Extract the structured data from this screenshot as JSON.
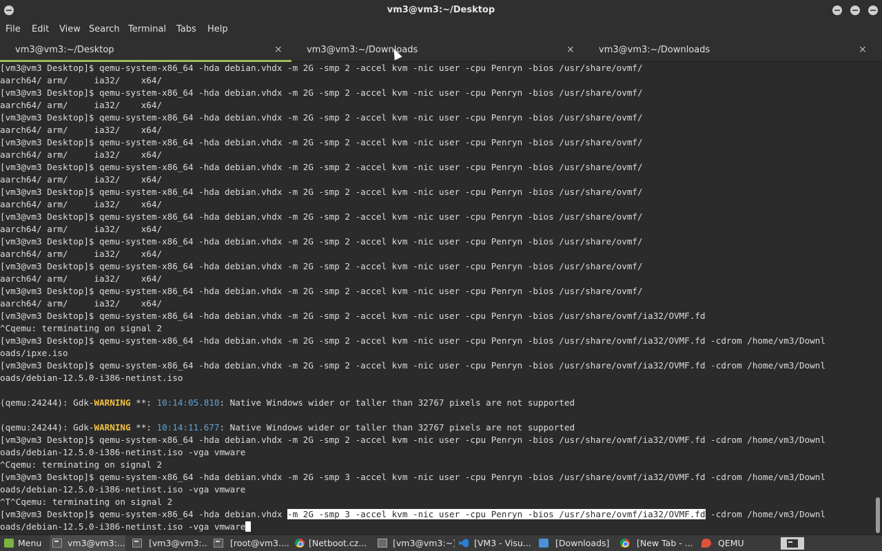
{
  "window": {
    "title": "vm3@vm3:~/Desktop"
  },
  "menu": [
    "File",
    "Edit",
    "View",
    "Search",
    "Terminal",
    "Tabs",
    "Help"
  ],
  "tabs": [
    {
      "label": "vm3@vm3:~/Desktop",
      "close": "×",
      "active": true
    },
    {
      "label": "vm3@vm3:~/Downloads",
      "close": "×",
      "active": false
    },
    {
      "label": "vm3@vm3:~/Downloads",
      "close": "×",
      "active": false
    }
  ],
  "terminal": {
    "lines": [
      "[vm3@vm3 Desktop]$ qemu-system-x86_64 -hda debian.vhdx -m 2G -smp 2 -accel kvm -nic user -cpu Penryn -bios /usr/share/ovmf/",
      "aarch64/ arm/     ia32/    x64/",
      "[vm3@vm3 Desktop]$ qemu-system-x86_64 -hda debian.vhdx -m 2G -smp 2 -accel kvm -nic user -cpu Penryn -bios /usr/share/ovmf/",
      "aarch64/ arm/     ia32/    x64/",
      "[vm3@vm3 Desktop]$ qemu-system-x86_64 -hda debian.vhdx -m 2G -smp 2 -accel kvm -nic user -cpu Penryn -bios /usr/share/ovmf/",
      "aarch64/ arm/     ia32/    x64/",
      "[vm3@vm3 Desktop]$ qemu-system-x86_64 -hda debian.vhdx -m 2G -smp 2 -accel kvm -nic user -cpu Penryn -bios /usr/share/ovmf/",
      "aarch64/ arm/     ia32/    x64/",
      "[vm3@vm3 Desktop]$ qemu-system-x86_64 -hda debian.vhdx -m 2G -smp 2 -accel kvm -nic user -cpu Penryn -bios /usr/share/ovmf/",
      "aarch64/ arm/     ia32/    x64/",
      "[vm3@vm3 Desktop]$ qemu-system-x86_64 -hda debian.vhdx -m 2G -smp 2 -accel kvm -nic user -cpu Penryn -bios /usr/share/ovmf/",
      "aarch64/ arm/     ia32/    x64/",
      "[vm3@vm3 Desktop]$ qemu-system-x86_64 -hda debian.vhdx -m 2G -smp 2 -accel kvm -nic user -cpu Penryn -bios /usr/share/ovmf/",
      "aarch64/ arm/     ia32/    x64/",
      "[vm3@vm3 Desktop]$ qemu-system-x86_64 -hda debian.vhdx -m 2G -smp 2 -accel kvm -nic user -cpu Penryn -bios /usr/share/ovmf/",
      "aarch64/ arm/     ia32/    x64/",
      "[vm3@vm3 Desktop]$ qemu-system-x86_64 -hda debian.vhdx -m 2G -smp 2 -accel kvm -nic user -cpu Penryn -bios /usr/share/ovmf/",
      "aarch64/ arm/     ia32/    x64/",
      "[vm3@vm3 Desktop]$ qemu-system-x86_64 -hda debian.vhdx -m 2G -smp 2 -accel kvm -nic user -cpu Penryn -bios /usr/share/ovmf/",
      "aarch64/ arm/     ia32/    x64/",
      "[vm3@vm3 Desktop]$ qemu-system-x86_64 -hda debian.vhdx -m 2G -smp 2 -accel kvm -nic user -cpu Penryn -bios /usr/share/ovmf/ia32/OVMF.fd",
      "^Cqemu: terminating on signal 2",
      "[vm3@vm3 Desktop]$ qemu-system-x86_64 -hda debian.vhdx -m 2G -smp 2 -accel kvm -nic user -cpu Penryn -bios /usr/share/ovmf/ia32/OVMF.fd -cdrom /home/vm3/Downl",
      "oads/ipxe.iso",
      "[vm3@vm3 Desktop]$ qemu-system-x86_64 -hda debian.vhdx -m 2G -smp 2 -accel kvm -nic user -cpu Penryn -bios /usr/share/ovmf/ia32/OVMF.fd -cdrom /home/vm3/Downl",
      "oads/debian-12.5.0-i386-netinst.iso",
      "",
      "(qemu:24244): Gdk-|WARNING| **: |10:14:05.810|: Native Windows wider or taller than 32767 pixels are not supported",
      "",
      "(qemu:24244): Gdk-|WARNING| **: |10:14:11.677|: Native Windows wider or taller than 32767 pixels are not supported",
      "[vm3@vm3 Desktop]$ qemu-system-x86_64 -hda debian.vhdx -m 2G -smp 2 -accel kvm -nic user -cpu Penryn -bios /usr/share/ovmf/ia32/OVMF.fd -cdrom /home/vm3/Downl",
      "oads/debian-12.5.0-i386-netinst.iso -vga vmware",
      "^Cqemu: terminating on signal 2",
      "[vm3@vm3 Desktop]$ qemu-system-x86_64 -hda debian.vhdx -m 2G -smp 3 -accel kvm -nic user -cpu Penryn -bios /usr/share/ovmf/ia32/OVMF.fd -cdrom /home/vm3/Downl",
      "oads/debian-12.5.0-i386-netinst.iso -vga vmware",
      "^T^Cqemu: terminating on signal 2"
    ],
    "last_command": {
      "before": "[vm3@vm3 Desktop]$ qemu-system-x86_64 -hda debian.vhdx ",
      "selected": "-m 2G -smp 3 -accel kvm -nic user -cpu Penryn -bios /usr/share/ovmf/ia32/OVMF.fd",
      "after": " -cdrom /home/vm3/Downl"
    },
    "current_line": "oads/debian-12.5.0-i386-netinst.iso -vga vmware"
  },
  "taskbar": {
    "menu_label": "Menu",
    "tasks": [
      {
        "label": "vm3@vm3:...",
        "icon": "terminal-icon"
      },
      {
        "label": "[vm3@vm3:...",
        "icon": "terminal-icon"
      },
      {
        "label": "[root@vm3....",
        "icon": "terminal-icon"
      },
      {
        "label": "[Netboot.cz...",
        "icon": "chrome-icon"
      },
      {
        "label": "[vm3@vm3:~]",
        "icon": "monitor-icon"
      },
      {
        "label": "[VM3 - Visu...",
        "icon": "vscode-icon"
      },
      {
        "label": "[Downloads]",
        "icon": "folder-icon"
      },
      {
        "label": "[New Tab - ...",
        "icon": "chrome-icon"
      },
      {
        "label": "QEMU",
        "icon": "qemu-icon"
      }
    ]
  },
  "colors": {
    "terminal_bg": "#2b2b2b",
    "terminal_fg": "#dcdcdc",
    "warning": "#f0c040",
    "timestamp": "#5fa3d6",
    "active_tab_underline": "#9bbd5b"
  }
}
